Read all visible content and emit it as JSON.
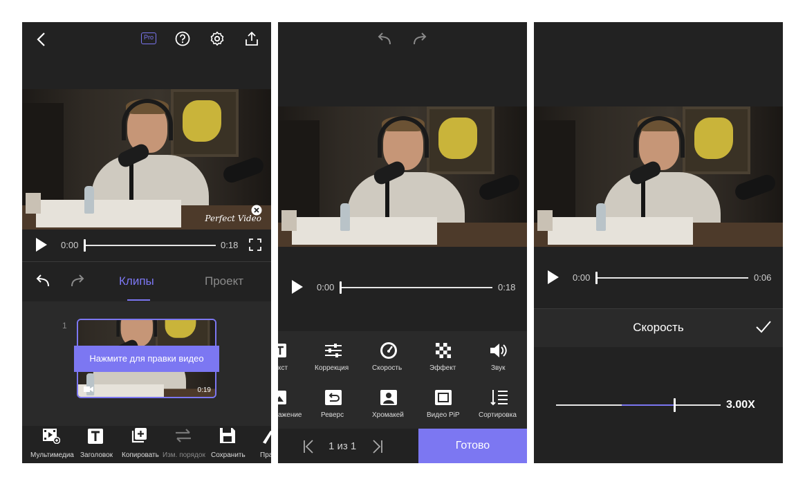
{
  "screen1": {
    "pro_badge": "Pro",
    "icons": [
      "back-arrow-icon",
      "pro-badge-icon",
      "help-icon",
      "gear-icon",
      "share-upload-icon"
    ],
    "watermark": "Perfect Video",
    "player": {
      "current_time": "0:00",
      "total_time": "0:18",
      "progress": 0.0
    },
    "tabs": {
      "clips": "Клипы",
      "project": "Проект",
      "active": "Клипы"
    },
    "clip": {
      "index": "1",
      "duration": "0:19",
      "tooltip": "Нажмите для правки видео"
    },
    "toolbar": [
      {
        "icon": "media-icon",
        "label": "Мультимедиа"
      },
      {
        "icon": "title-icon",
        "label": "Заголовок"
      },
      {
        "icon": "copy-icon",
        "label": "Копировать"
      },
      {
        "icon": "reorder-icon",
        "label": "Изм. порядок",
        "disabled": true
      },
      {
        "icon": "save-icon",
        "label": "Сохранить"
      },
      {
        "icon": "brush-icon",
        "label": "Пра"
      }
    ],
    "accent": "#7c77f2"
  },
  "screen2": {
    "player": {
      "current_time": "0:00",
      "total_time": "0:18",
      "progress": 0.0
    },
    "tools_row1": [
      {
        "icon": "text-icon",
        "label": "кст"
      },
      {
        "icon": "sliders-icon",
        "label": "Коррекция"
      },
      {
        "icon": "speedometer-icon",
        "label": "Скорость"
      },
      {
        "icon": "checker-icon",
        "label": "Эффект"
      },
      {
        "icon": "speaker-icon",
        "label": "Звук"
      }
    ],
    "tools_row2": [
      {
        "icon": "image-icon",
        "label": "ажение"
      },
      {
        "icon": "reverse-icon",
        "label": "Реверс"
      },
      {
        "icon": "chroma-icon",
        "label": "Хромакей"
      },
      {
        "icon": "pip-icon",
        "label": "Видео PiP"
      },
      {
        "icon": "sort-icon",
        "label": "Сортировка"
      }
    ],
    "pager": "1 из 1",
    "done_button": "Готово",
    "accent": "#7c77f2"
  },
  "screen3": {
    "player": {
      "current_time": "0:00",
      "total_time": "0:06",
      "progress": 0.0
    },
    "speed_title": "Скорость",
    "speed_value": "3.00X",
    "speed_slider": 0.66,
    "accent": "#7c77f2"
  }
}
